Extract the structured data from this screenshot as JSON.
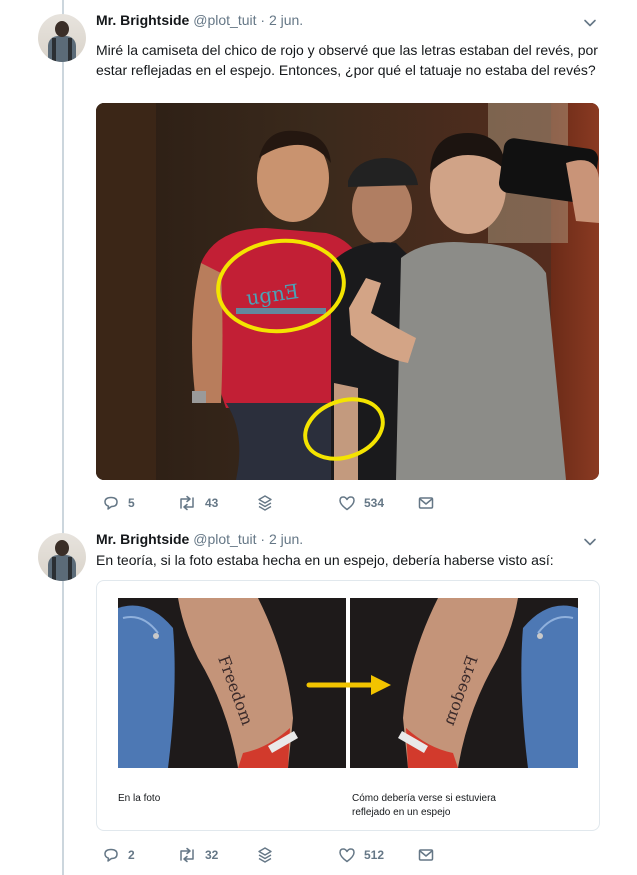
{
  "tweets": [
    {
      "name": "Mr. Brightside",
      "handle": "@plot_tuit",
      "date": "2 jun.",
      "text": "Miré la camiseta del chico de rojo y observé que las letras estaban del revés, por estar reflejadas en el espejo. Entonces, ¿por qué el tatuaje no estaba del revés?",
      "stats": {
        "replies": "5",
        "retweets": "43",
        "likes": "534"
      }
    },
    {
      "name": "Mr. Brightside",
      "handle": "@plot_tuit",
      "date": "2 jun.",
      "text": "En teoría, si la foto estaba hecha en un espejo, debería haberse visto así:",
      "stats": {
        "replies": "2",
        "retweets": "32",
        "likes": "512"
      },
      "card": {
        "caption_left": "En la foto",
        "caption_right": "Cómo debería verse si estuviera reflejado en un espejo",
        "tattoo_text": "Freedom"
      }
    }
  ],
  "separator": "·",
  "colors": {
    "text": "#14171a",
    "muted": "#657786",
    "highlight": "#f4e400",
    "arrow": "#f2c400"
  },
  "icons": [
    "chevron-down-icon",
    "reply-icon",
    "retweet-icon",
    "stack-icon",
    "heart-icon",
    "mail-icon"
  ]
}
